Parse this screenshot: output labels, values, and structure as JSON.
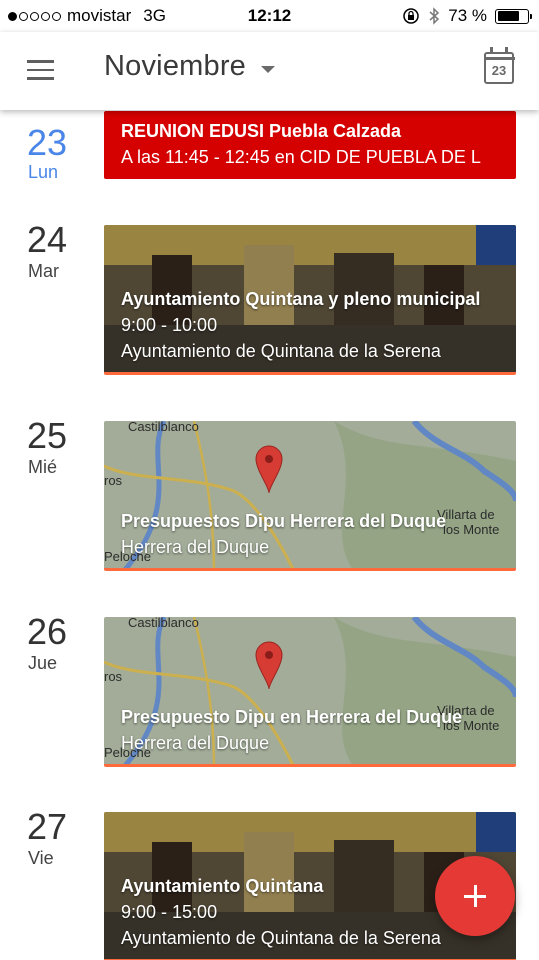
{
  "status_bar": {
    "carrier": "movistar",
    "network": "3G",
    "time": "12:12",
    "battery_percent": "73 %",
    "battery_level": 0.73,
    "signal_bars_filled": 1,
    "signal_bars_total": 5
  },
  "app_bar": {
    "month": "Noviembre",
    "today_icon_day": "23"
  },
  "days": [
    {
      "num": "23",
      "name": "Lun",
      "is_today": true,
      "event": {
        "title": "REUNION EDUSI Puebla Calzada",
        "subtitle": "A las 11:45 - 12:45 en CID DE PUEBLA DE L",
        "style": "red"
      }
    },
    {
      "num": "24",
      "name": "Mar",
      "event": {
        "title": "Ayuntamiento Quintana y pleno municipal",
        "time": "9:00 - 10:00",
        "location": "Ayuntamiento de Quintana de la Serena",
        "background": "building-photo"
      }
    },
    {
      "num": "25",
      "name": "Mié",
      "event": {
        "title": "Presupuestos Dipu Herrera del Duque",
        "location": "Herrera del Duque",
        "background": "map",
        "map_labels": [
          "Castilblanco",
          "ros",
          "Villarta de",
          "los Monte",
          "Peloche"
        ]
      }
    },
    {
      "num": "26",
      "name": "Jue",
      "event": {
        "title": "Presupuesto Dipu en Herrera del Duque",
        "location": "Herrera del Duque",
        "background": "map",
        "map_labels": [
          "Castilblanco",
          "ros",
          "Villarta de",
          "los Monte",
          "Peloche"
        ]
      }
    },
    {
      "num": "27",
      "name": "Vie",
      "event": {
        "title": "Ayuntamiento Quintana",
        "time": "9:00 - 15:00",
        "location": "Ayuntamiento de Quintana de la Serena",
        "background": "building-photo"
      }
    }
  ],
  "colors": {
    "today_blue": "#4a86e8",
    "event_red": "#d50000",
    "fab_red": "#e53935",
    "card_underline": "#ff6a3d"
  },
  "icons": {
    "menu": "hamburger-menu-icon",
    "dropdown": "caret-down-icon",
    "today": "calendar-today-icon",
    "fab": "plus-icon",
    "map_pin": "map-pin-icon"
  }
}
